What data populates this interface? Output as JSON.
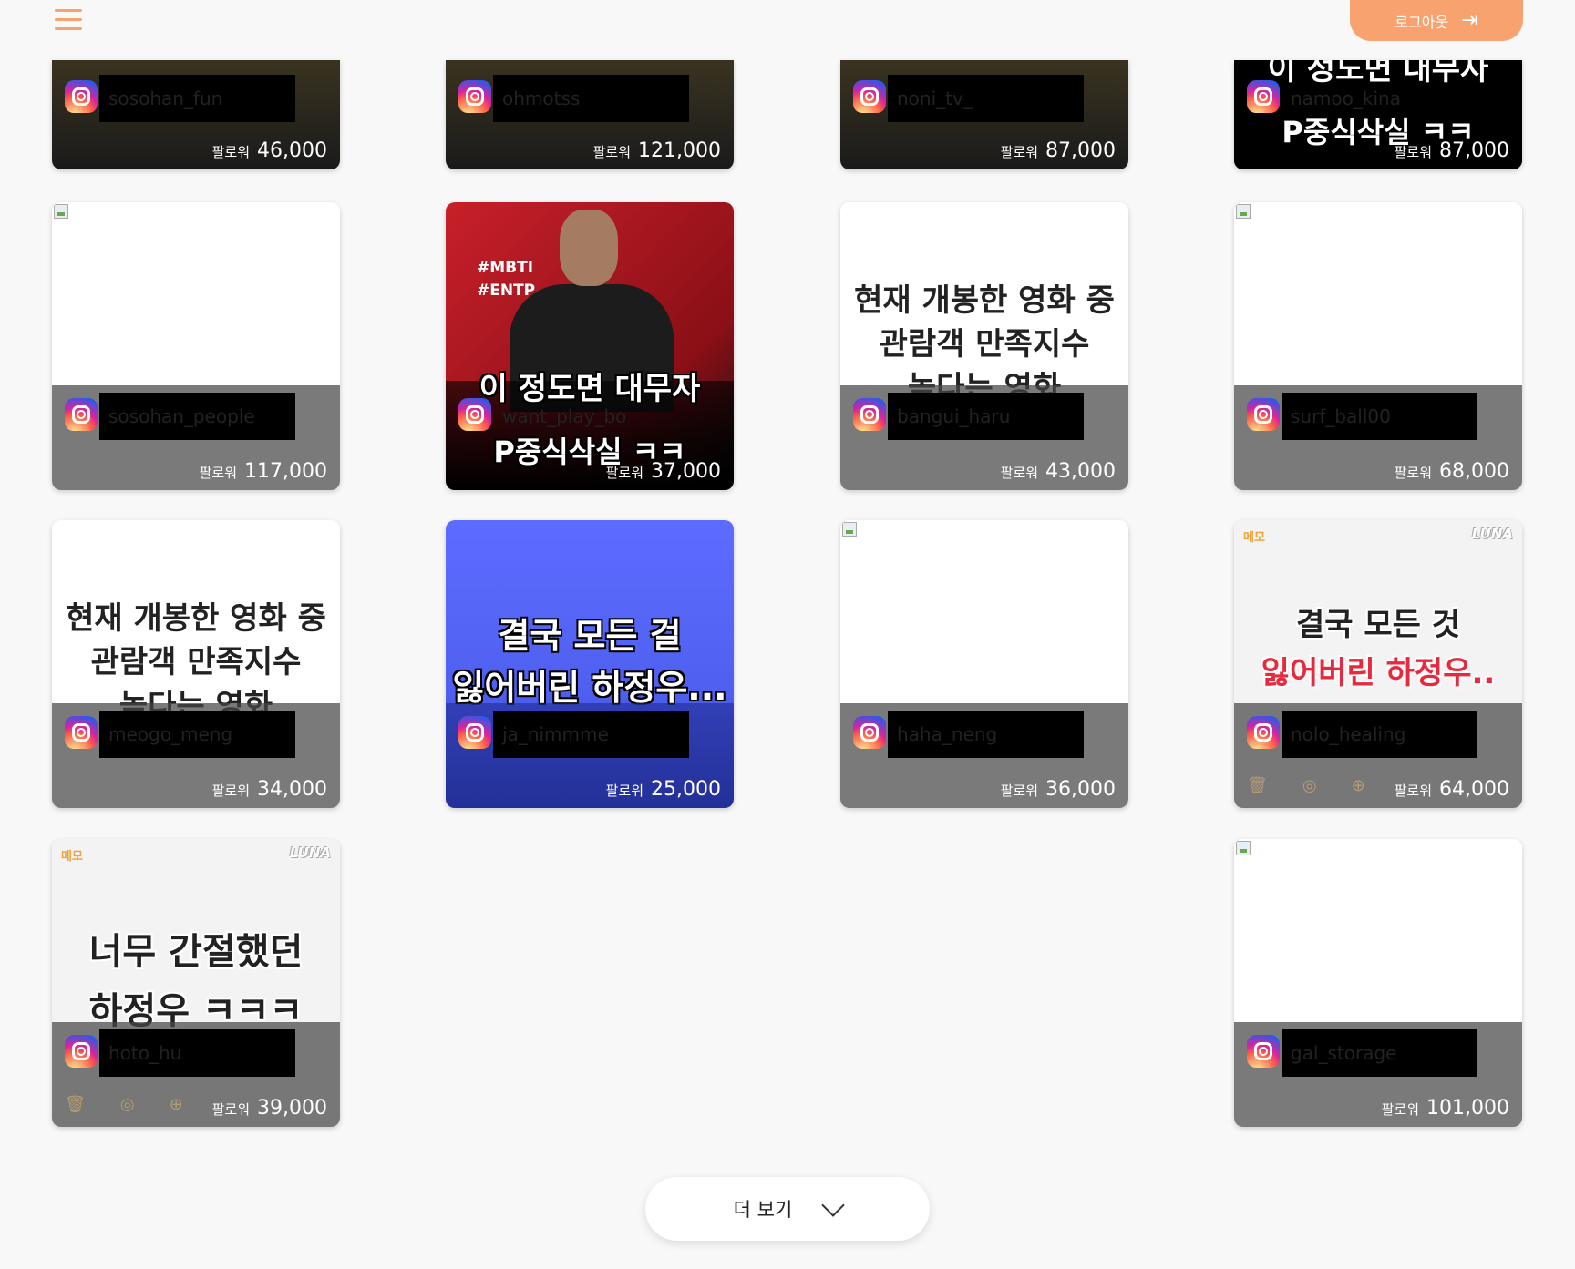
{
  "header": {
    "menu_icon": "hamburger-menu-icon",
    "logout_label": "로그아웃",
    "logout_icon": "logout-arrow-icon",
    "accent_color": "#f8a36f"
  },
  "follower_label": "팔로워",
  "cards": [
    {
      "username": "sosohan_fun",
      "followers": "46,000"
    },
    {
      "username": "ohmotss",
      "followers": "121,000"
    },
    {
      "username": "noni_tv_",
      "followers": "87,000"
    },
    {
      "username": "namoo_kina",
      "followers": "87,000",
      "poster_lines": [
        "이 정도면 대무자",
        "P중식삭실 ㅋㅋ"
      ]
    },
    {
      "username": "sosohan_people",
      "followers": "117,000"
    },
    {
      "username": "want_play_bo",
      "followers": "37,000",
      "tags": [
        "#MBTI",
        "#ENTP"
      ],
      "poster_lines": [
        "이 정도면 대무자",
        "P중식삭실 ㅋㅋ"
      ]
    },
    {
      "username": "bangui_haru",
      "followers": "43,000",
      "poster_lines": [
        "현재 개봉한 영화 중",
        "관람객 만족지수",
        "높다는 영화"
      ]
    },
    {
      "username": "surf_ball00",
      "followers": "68,000"
    },
    {
      "username": "meogo_meng",
      "followers": "34,000",
      "poster_lines": [
        "현재 개봉한 영화 중",
        "관람객 만족지수",
        "높다는 영화"
      ]
    },
    {
      "username": "ja_nimmme",
      "followers": "25,000",
      "poster_lines": [
        "결국 모든 걸",
        "잃어버린 하정우..."
      ]
    },
    {
      "username": "haha_neng",
      "followers": "36,000"
    },
    {
      "username": "nolo_healing",
      "followers": "64,000",
      "memo": "메모",
      "luna": "LUNA",
      "poster_lines": [
        "결국 모든 것",
        "잃어버린 하정우.."
      ]
    },
    {
      "username": "hoto_hu",
      "followers": "39,000",
      "memo": "메모",
      "luna": "LUNA",
      "poster_lines": [
        "너무 간절했던",
        "하정우 ㅋㅋㅋ"
      ]
    },
    {
      "username": "gal_storage",
      "followers": "101,000"
    }
  ],
  "more_button": {
    "label": "더 보기",
    "icon": "chevron-down-icon"
  }
}
